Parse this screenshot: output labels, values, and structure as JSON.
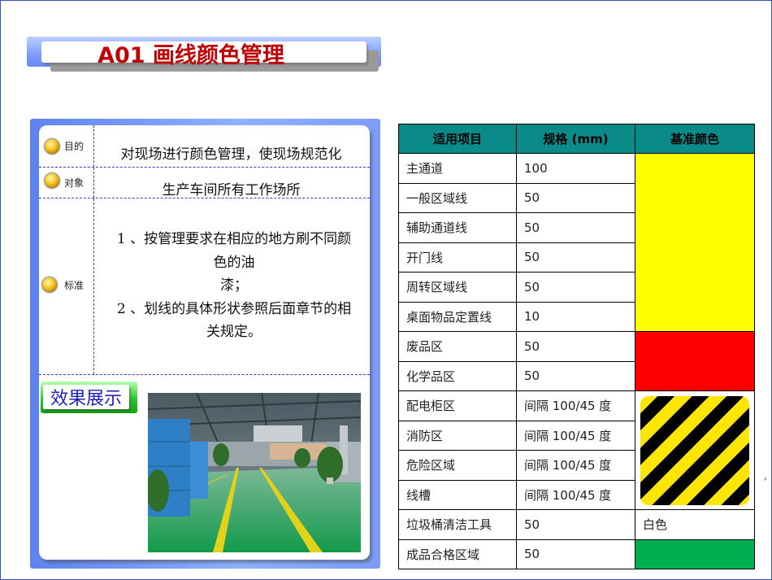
{
  "title": "A01 画线颜色管理",
  "info": [
    {
      "label": "目的",
      "text": "对现场进行颜色管理，使现场规范化"
    },
    {
      "label": "对象",
      "text": "生产车间所有工作场所"
    },
    {
      "label": "标准",
      "lines": [
        "1 、按管理要求在相应的地方刷不同颜",
        "色的油",
        "漆；",
        "2 、划线的具体形状参照后面章节的相",
        "关规定。"
      ]
    }
  ],
  "effect_label": "效果展示",
  "table": {
    "headers": [
      "适用项目",
      "规格 (mm)",
      "基准颜色"
    ],
    "rows": [
      {
        "item": "主通道",
        "spec": "100"
      },
      {
        "item": "一般区域线",
        "spec": "50"
      },
      {
        "item": "辅助通道线",
        "spec": "50"
      },
      {
        "item": "开门线",
        "spec": "50"
      },
      {
        "item": "周转区域线",
        "spec": "50"
      },
      {
        "item": "桌面物品定置线",
        "spec": "10"
      },
      {
        "item": "废品区",
        "spec": "50"
      },
      {
        "item": "化学品区",
        "spec": "50"
      },
      {
        "item": "配电柜区",
        "spec": "间隔 100/45 度"
      },
      {
        "item": "消防区",
        "spec": "间隔 100/45 度"
      },
      {
        "item": "危险区域",
        "spec": "间隔 100/45 度"
      },
      {
        "item": "线槽",
        "spec": "间隔 100/45 度"
      },
      {
        "item": "垃圾桶清洁工具",
        "spec": "50",
        "color_text": "白色"
      },
      {
        "item": "成品合格区域",
        "spec": "50"
      }
    ],
    "colors": {
      "yellow": "#ffff00",
      "red": "#ff0000",
      "stripe": "yellow-black",
      "green": "#00b050",
      "header_bg": "#0b8a8a"
    }
  },
  "stray_mark": ","
}
